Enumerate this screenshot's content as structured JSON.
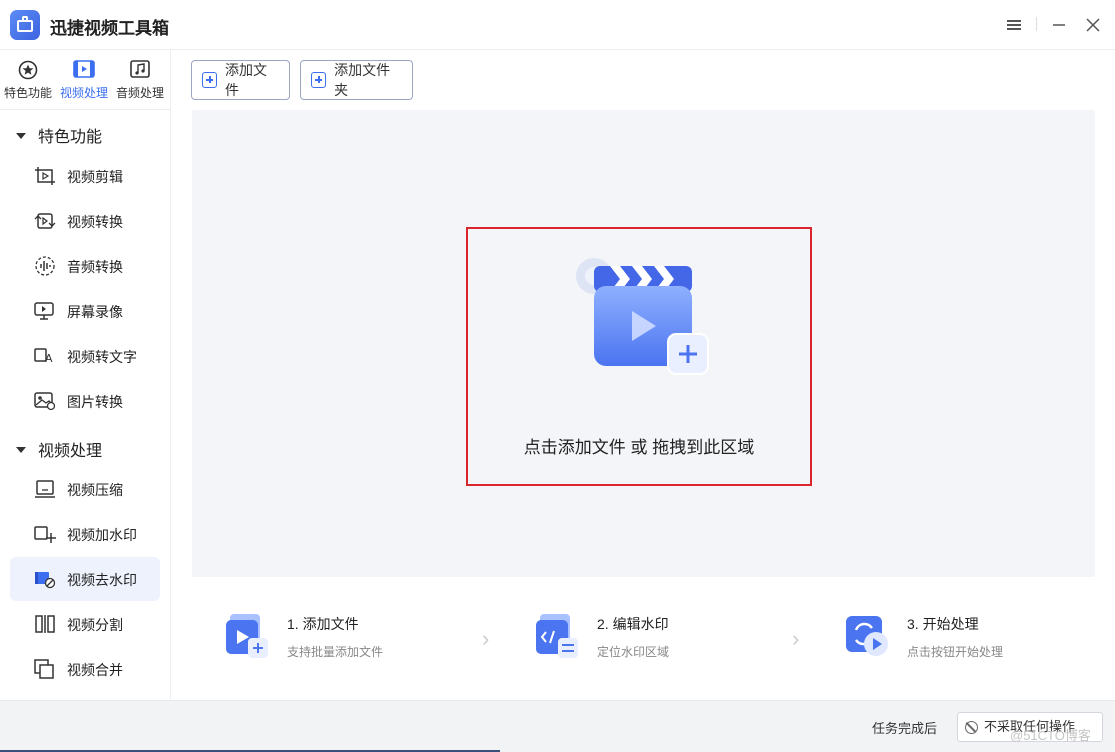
{
  "app": {
    "title": "迅捷视频工具箱"
  },
  "window": {
    "menu_icon": "hamburger-icon",
    "minimize_icon": "minimize-icon",
    "close_icon": "close-icon"
  },
  "colors": {
    "accent": "#3b6ff0",
    "highlight_border": "#d9262c",
    "active_item_bg": "#eef2fd"
  },
  "sidebar": {
    "top_tabs": [
      {
        "label": "特色功能",
        "icon": "star-icon",
        "active": false
      },
      {
        "label": "视频处理",
        "icon": "film-icon",
        "active": true
      },
      {
        "label": "音频处理",
        "icon": "music-icon",
        "active": false
      }
    ],
    "groups": [
      {
        "label": "特色功能",
        "items": [
          {
            "label": "视频剪辑",
            "icon": "crop-video-icon"
          },
          {
            "label": "视频转换",
            "icon": "convert-video-icon"
          },
          {
            "label": "音频转换",
            "icon": "audio-wave-icon"
          },
          {
            "label": "屏幕录像",
            "icon": "screen-record-icon"
          },
          {
            "label": "视频转文字",
            "icon": "video-to-text-icon"
          },
          {
            "label": "图片转换",
            "icon": "image-convert-icon"
          }
        ]
      },
      {
        "label": "视频处理",
        "items": [
          {
            "label": "视频压缩",
            "icon": "compress-icon"
          },
          {
            "label": "视频加水印",
            "icon": "add-watermark-icon"
          },
          {
            "label": "视频去水印",
            "icon": "remove-watermark-icon",
            "active": true
          },
          {
            "label": "视频分割",
            "icon": "split-icon"
          },
          {
            "label": "视频合并",
            "icon": "merge-icon"
          }
        ]
      }
    ]
  },
  "toolbar": {
    "add_file": "添加文件",
    "add_folder": "添加文件夹"
  },
  "dropzone": {
    "text": "点击添加文件 或 拖拽到此区域",
    "icon": "video-clapper-add-icon"
  },
  "steps": [
    {
      "title": "1. 添加文件",
      "desc": "支持批量添加文件",
      "icon": "add-file-step-icon"
    },
    {
      "title": "2. 编辑水印",
      "desc": "定位水印区域",
      "icon": "edit-watermark-step-icon"
    },
    {
      "title": "3. 开始处理",
      "desc": "点击按钮开始处理",
      "icon": "start-process-step-icon"
    }
  ],
  "status": {
    "label": "任务完成后",
    "select_value": "不采取任何操作"
  },
  "watermark": "@51CTO博客"
}
